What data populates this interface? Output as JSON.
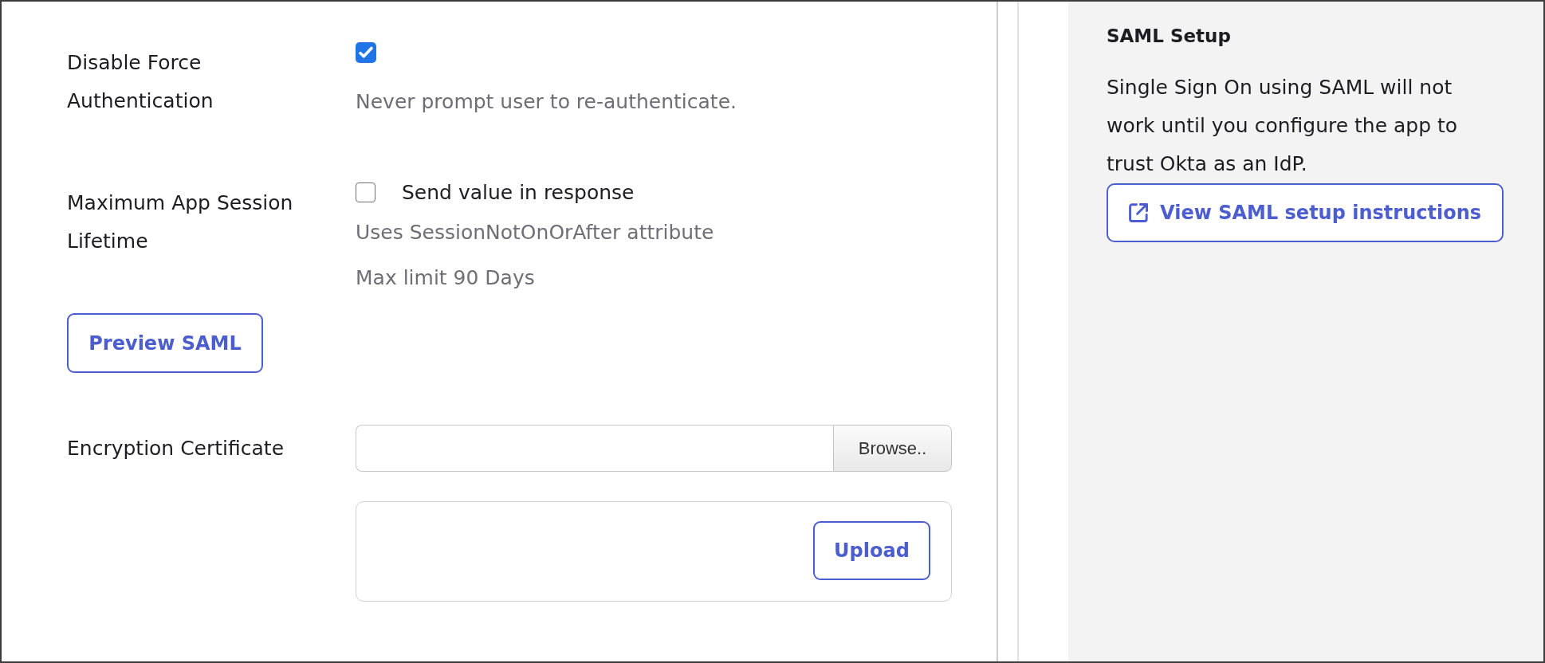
{
  "settings": [
    {
      "kind": "checkbox",
      "label": "Disable Force Authentication",
      "checked": true,
      "help": [
        "Never prompt user to re-authenticate."
      ]
    },
    {
      "kind": "checkbox",
      "label": "Maximum App Session Lifetime",
      "checked": false,
      "option": "Send value in response",
      "help": [
        "Uses SessionNotOnOrAfter attribute",
        "Max limit 90 Days"
      ]
    }
  ],
  "preview_button": "Preview SAML",
  "encryption_certificate": {
    "label": "Encryption Certificate",
    "browse_button": "Browse..",
    "upload_button": "Upload"
  },
  "side_panel": {
    "title": "SAML Setup",
    "text": "Single Sign On using SAML will not work until you configure the app to trust Okta as an IdP.",
    "button": "View SAML setup instructions"
  }
}
